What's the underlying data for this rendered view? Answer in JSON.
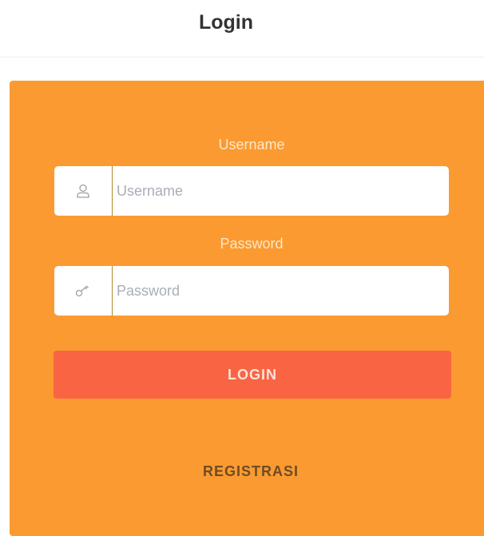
{
  "header": {
    "title": "Login"
  },
  "form": {
    "username": {
      "label": "Username",
      "placeholder": "Username",
      "value": "",
      "icon": "user-icon"
    },
    "password": {
      "label": "Password",
      "placeholder": "Password",
      "value": "",
      "icon": "key-icon"
    },
    "login_label": "LOGIN",
    "register_label": "REGISTRASI"
  },
  "colors": {
    "card": "#fb9a31",
    "button": "#f96443",
    "label": "#fde8c8",
    "register_text": "#6e4d22"
  }
}
